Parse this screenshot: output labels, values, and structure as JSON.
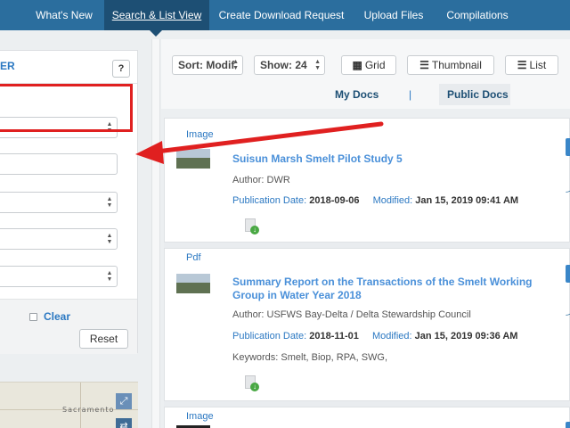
{
  "nav": {
    "items": [
      {
        "label": "What's New"
      },
      {
        "label": "Search & List View"
      },
      {
        "label": "Create Download Request"
      },
      {
        "label": "Upload Files"
      },
      {
        "label": "Compilations"
      }
    ],
    "active_index": 1
  },
  "filter": {
    "title": "ER",
    "help_label": "?",
    "clear_label": "Clear",
    "reset_label": "Reset"
  },
  "map": {
    "place_label": "Sacramento",
    "expand_icon": "expand-icon",
    "layers_icon": "layers-icon"
  },
  "toolbar": {
    "sort_label": "Sort: Modif",
    "show_label": "Show: 24",
    "grid_label": "Grid",
    "thumbnail_label": "Thumbnail",
    "list_label": "List",
    "my_docs_label": "My Docs",
    "separator": "|",
    "public_docs_label": "Public Docs"
  },
  "results": [
    {
      "type": "Image",
      "title": "Suisun Marsh Smelt Pilot Study 5",
      "author_label": "Author:",
      "author": "DWR",
      "pub_label": "Publication Date:",
      "pub_date": "2018-09-06",
      "mod_label": "Modified:",
      "modified": "Jan 15, 2019 09:41 AM"
    },
    {
      "type": "Pdf",
      "title": "Summary Report on the Transactions of the Smelt Working Group in Water Year 2018",
      "author_label": "Author:",
      "author": "USFWS Bay-Delta / Delta Stewardship Council",
      "pub_label": "Publication Date:",
      "pub_date": "2018-11-01",
      "mod_label": "Modified:",
      "modified": "Jan 15, 2019 09:36 AM",
      "keywords_label": "Keywords:",
      "keywords": "Smelt, Biop, RPA, SWG,"
    },
    {
      "type": "Image"
    }
  ],
  "colors": {
    "nav_bg": "#2b6e9e",
    "link": "#4a90d9",
    "highlight": "#e02020",
    "download_green": "#49a843"
  }
}
